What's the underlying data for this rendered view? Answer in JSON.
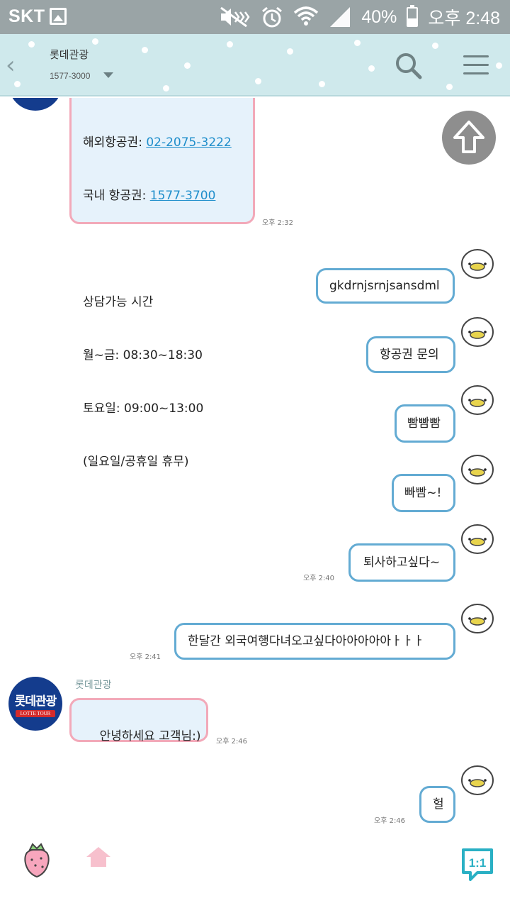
{
  "status_bar": {
    "carrier": "SKT",
    "battery": "40%",
    "battery_level": 0.4,
    "time": "오후 2:48",
    "icons": [
      "image-icon",
      "mute-icon",
      "alarm-icon",
      "wifi-icon",
      "signal-icon",
      "battery-icon"
    ]
  },
  "header": {
    "title": "롯데관광",
    "subtitle": "1577-3000",
    "icons": [
      "back-icon",
      "search-icon",
      "menu-icon"
    ],
    "bg_color": "#cfe9ec"
  },
  "messages": {
    "m1": {
      "line1_label": "해외항공권: ",
      "line1_link": "02-2075-3222",
      "line2_label": "국내 항공권: ",
      "line2_link": "1577-3700",
      "hours_title": "상담가능 시간",
      "weekday": "월~금: 08:30~18:30",
      "saturday": "토요일: 09:00~13:00",
      "closed": "(일요일/공휴일 휴무)",
      "time": "오후 2:32"
    },
    "m2": {
      "text": "gkdrnjsrnjsansdml"
    },
    "m3": {
      "text": "항공권 문의"
    },
    "m4": {
      "text": "빰빰빰"
    },
    "m5": {
      "text": "빠빰~!"
    },
    "m6": {
      "text": "퇴사하고싶다~",
      "time": "오후 2:40"
    },
    "m7": {
      "text": "한달간 외국여행다녀오고싶다아아아아아ㅏㅏㅏ",
      "time": "오후 2:41"
    },
    "m8": {
      "sender": "롯데관광",
      "avatar_top": "롯데관광",
      "avatar_bottom": "LOTTE TOUR",
      "text": "안녕하세요 고객님:)",
      "time": "오후 2:46"
    },
    "m9": {
      "text": "헐",
      "time": "오후 2:46"
    }
  },
  "colors": {
    "incoming_border": "#f2a9b9",
    "incoming_bg": "#e6f2fb",
    "outgoing_border": "#63abd3",
    "link": "#1f8ecb"
  },
  "bottom_bar": {
    "icons": [
      "strawberry-icon",
      "home-icon",
      "one-to-one-chat-icon"
    ],
    "chat11_label": "1:1"
  },
  "scroll_top": {
    "icon": "arrow-up-icon"
  }
}
